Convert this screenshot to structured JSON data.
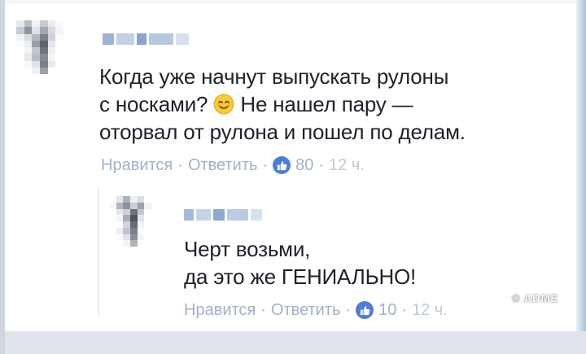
{
  "comments": [
    {
      "text": "Когда уже начнут выпускать рулоны\nс носками? ",
      "text_after_emoji": " Не нашел пару —\nоторвал от рулона и пошел по делам.",
      "emoji_icon": "smiling-face-icon",
      "like_label": "Нравится",
      "reply_label": "Ответить",
      "likes": "80",
      "time": "12 ч."
    },
    {
      "text": "Черт возьми,\nда это же ГЕНИАЛЬНО!",
      "like_label": "Нравится",
      "reply_label": "Ответить",
      "likes": "10",
      "time": "12 ч."
    }
  ],
  "watermark": "© ADME",
  "colors": {
    "text": "#1d2129",
    "meta": "#8e9db8",
    "like_badge": "#4d7dd6"
  }
}
